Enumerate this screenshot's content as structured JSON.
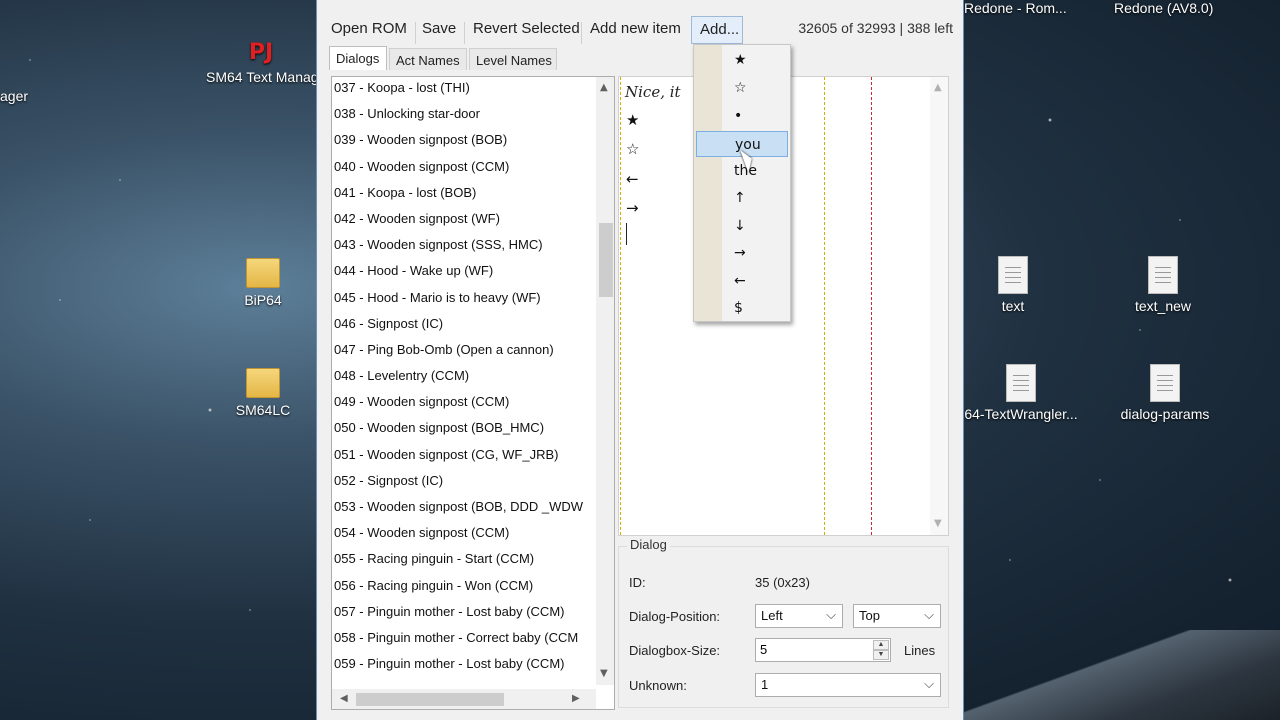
{
  "desktop": {
    "left_edge_label": "ager",
    "icons": [
      {
        "label": "SM64 Text Manag",
        "type": "pj"
      },
      {
        "label": "BiP64",
        "type": "folder"
      },
      {
        "label": "SM64LC",
        "type": "folder"
      },
      {
        "label": "text",
        "type": "file"
      },
      {
        "label": "text_new",
        "type": "file"
      },
      {
        "label": "64-TextWrangler...",
        "type": "file"
      },
      {
        "label": "dialog-params",
        "type": "file"
      }
    ],
    "top_right_labels": [
      "Redone - Rom...",
      "Redone (AV8.0)"
    ]
  },
  "toolbar": {
    "open_rom": "Open ROM",
    "save": "Save",
    "revert_selected": "Revert Selected",
    "add_new_item": "Add new item",
    "add": "Add...",
    "status": "32605 of 32993 | 388 left"
  },
  "tabs": [
    "Dialogs",
    "Act Names",
    "Level Names"
  ],
  "dialogs": [
    "037 - Koopa - lost (THI)",
    "038 - Unlocking star-door",
    "039 - Wooden signpost (BOB)",
    "040 - Wooden signpost (CCM)",
    "041 - Koopa - lost (BOB)",
    "042 - Wooden signpost (WF)",
    "043 - Wooden signpost (SSS, HMC)",
    "044 - Hood - Wake up (WF)",
    "045 - Hood - Mario is to heavy (WF)",
    "046 - Signpost (IC)",
    "047 - Ping Bob-Omb (Open a cannon)",
    "048 - Levelentry (CCM)",
    "049 - Wooden signpost (CCM)",
    "050 - Wooden signpost (BOB_HMC)",
    "051 - Wooden signpost (CG, WF_JRB)",
    "052 - Signpost (IC)",
    "053 - Wooden signpost (BOB, DDD _WDW",
    "054 - Wooden signpost (CCM)",
    "055 - Racing pinguin - Start (CCM)",
    "056 - Racing pinguin - Won (CCM)",
    "057 - Pinguin mother - Lost baby (CCM)",
    "058 - Pinguin mother - Correct baby (CCM",
    "059 - Pinguin mother - Lost baby (CCM)"
  ],
  "editor": {
    "first_line": "Nice, it",
    "glyph_lines": [
      "★",
      "☆",
      "←",
      "→"
    ],
    "guide_colors": [
      "#d4b000",
      "#cc2b2b"
    ]
  },
  "add_menu": {
    "items": [
      "★",
      "☆",
      "•",
      "you",
      "the",
      "↑",
      "↓",
      "→",
      "←",
      "$"
    ],
    "highlighted": "you"
  },
  "dialog_group": {
    "title": "Dialog",
    "id_label": "ID:",
    "id_value": "35 (0x23)",
    "position_label": "Dialog-Position:",
    "position_h": "Left",
    "position_v": "Top",
    "size_label": "Dialogbox-Size:",
    "size_value": "5",
    "size_unit": "Lines",
    "unknown_label": "Unknown:",
    "unknown_value": "1"
  },
  "colors": {
    "window_border": "#6d8fb5",
    "menu_highlight": "#c9dff4",
    "pj_logo": "#e02020"
  }
}
